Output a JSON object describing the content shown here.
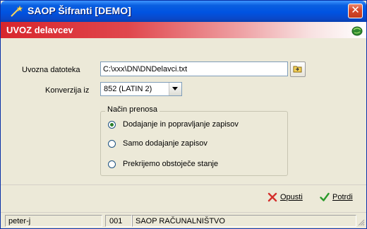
{
  "window": {
    "title": "SAOP Šifranti [DEMO]",
    "close_label": "✕"
  },
  "header": {
    "title": "UVOZ delavcev"
  },
  "form": {
    "file_label": "Uvozna datoteka",
    "file_value": "C:\\xxx\\DN\\DNDelavci.txt",
    "conversion_label": "Konverzija iz",
    "conversion_value": "852 (LATIN 2)"
  },
  "transfer_mode": {
    "title": "Način prenosa",
    "options": [
      {
        "label": "Dodajanje in popravljanje zapisov",
        "selected": true
      },
      {
        "label": "Samo dodajanje zapisov",
        "selected": false
      },
      {
        "label": "Prekrijemo obstoječe stanje",
        "selected": false
      }
    ]
  },
  "actions": {
    "cancel_label": "Opusti",
    "confirm_label": "Potrdi"
  },
  "status_bar": {
    "user": "peter-j",
    "company_code": "001",
    "company_name": "SAOP RAČUNALNIŠTVO"
  },
  "colors": {
    "titlebar_blue": "#0053e1",
    "header_red": "#d8262c",
    "close_red": "#d6482a",
    "cancel_icon_red": "#d4302c",
    "confirm_icon_green": "#2a9a2a"
  },
  "icons": {
    "app": "wand-star-icon",
    "header": "globe-icon",
    "browse": "folder-open-icon",
    "cancel": "x-icon",
    "confirm": "check-icon"
  }
}
